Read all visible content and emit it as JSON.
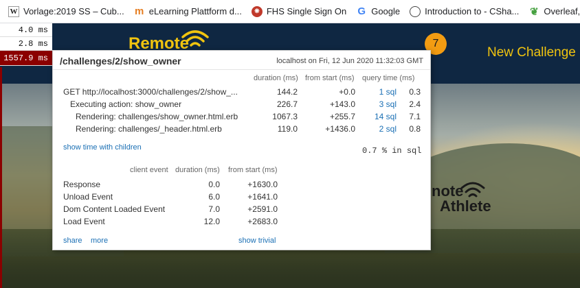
{
  "bookmarks": [
    {
      "icon": "wikipedia-icon",
      "glyph": "W",
      "label": "Vorlage:2019 SS – Cub..."
    },
    {
      "icon": "moodle-icon",
      "glyph": "m",
      "label": "eLearning Plattform d..."
    },
    {
      "icon": "fhs-icon",
      "glyph": "❋",
      "label": "FHS Single Sign On"
    },
    {
      "icon": "google-icon",
      "glyph": "G",
      "label": "Google"
    },
    {
      "icon": "globe-icon",
      "glyph": "",
      "label": "Introduction to - CSha..."
    },
    {
      "icon": "overleaf-icon",
      "glyph": "❦",
      "label": "Overleaf, Online LaTeX..."
    }
  ],
  "site": {
    "logo_text": "Remote",
    "nav_link": "New Challenge",
    "badge_count": "7",
    "logo2_top": "note",
    "logo2_bottom": "Athlete",
    "colors": {
      "header": "#0f2742",
      "accent": "#f1c40f",
      "badge": "#f39c12"
    }
  },
  "profiler_tabs": [
    "4.0 ms",
    "2.8 ms",
    "1557.9 ms"
  ],
  "popup": {
    "name": "/challenges/2/show_owner",
    "server_info": "localhost on Fri, 12 Jun 2020 11:32:03 GMT",
    "headers": {
      "duration": "duration (ms)",
      "from_start": "from start (ms)",
      "query_time": "query time (ms)"
    },
    "timings": [
      {
        "name": "GET http://localhost:3000/challenges/2/show_...",
        "duration": "144.2",
        "from_start": "+0.0",
        "sql": "1 sql",
        "query_time": "0.3"
      },
      {
        "name": "Executing action: show_owner",
        "duration": "226.7",
        "from_start": "+143.0",
        "sql": "3 sql",
        "query_time": "2.4"
      },
      {
        "name": "Rendering: challenges/show_owner.html.erb",
        "duration": "1067.3",
        "from_start": "+255.7",
        "sql": "14 sql",
        "query_time": "7.1"
      },
      {
        "name": "Rendering: challenges/_header.html.erb",
        "duration": "119.0",
        "from_start": "+1436.0",
        "sql": "2 sql",
        "query_time": "0.8"
      }
    ],
    "show_children": "show time with children",
    "sql_pct": "0.7",
    "sql_pct_suffix": "% in sql",
    "client_headers": {
      "event": "client event",
      "duration": "duration (ms)",
      "from_start": "from start (ms)"
    },
    "client_events": [
      {
        "name": "Response",
        "duration": "0.0",
        "from_start": "+1630.0"
      },
      {
        "name": "Unload Event",
        "duration": "6.0",
        "from_start": "+1641.0"
      },
      {
        "name": "Dom Content Loaded Event",
        "duration": "7.0",
        "from_start": "+2591.0"
      },
      {
        "name": "Load Event",
        "duration": "12.0",
        "from_start": "+2683.0"
      }
    ],
    "links": {
      "share": "share",
      "more": "more",
      "show_trivial": "show trivial"
    }
  }
}
